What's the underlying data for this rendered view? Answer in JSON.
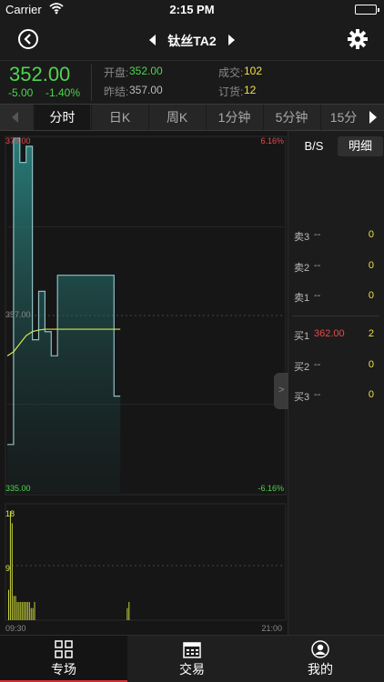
{
  "status_bar": {
    "carrier": "Carrier",
    "time": "2:15 PM"
  },
  "nav": {
    "title": "钛丝TA2"
  },
  "quote": {
    "price": "352.00",
    "change": "-5.00",
    "change_pct": "-1.40%",
    "open_label": "开盘:",
    "open_value": "352.00",
    "prev_settle_label": "昨结:",
    "prev_settle_value": "357.00",
    "volume_label": "成交:",
    "volume_value": "102",
    "orders_label": "订货:",
    "orders_value": "12"
  },
  "tabs": [
    "分时",
    "日K",
    "周K",
    "1分钟",
    "5分钟",
    "15分"
  ],
  "active_tab": 0,
  "chart_data": [
    {
      "type": "line",
      "title": "",
      "y_left_ticks": [
        "379.00",
        "357.00",
        "335.00"
      ],
      "y_right_ticks": [
        "6.16%",
        "-6.16%"
      ],
      "ylim": [
        335.0,
        379.0
      ],
      "series": [
        {
          "values": [
            341.0,
            379.0,
            376.0,
            378.0,
            354.0,
            360.0,
            355.0,
            352.0,
            362.0,
            362.0,
            362.0,
            362.0,
            362.0,
            362.0,
            362.0,
            362.0,
            362.0,
            347.0
          ]
        },
        {
          "values": [
            352.0,
            352.5,
            353.5,
            354.5,
            355.0,
            355.2,
            355.3,
            355.3,
            355.3,
            355.3,
            355.3,
            355.3,
            355.3,
            355.3,
            355.3,
            355.3,
            355.3,
            355.3
          ]
        }
      ]
    },
    {
      "type": "bar",
      "title": "",
      "y_ticks": [
        "18",
        "9"
      ],
      "x_ticks": [
        "09:30",
        "21:00"
      ],
      "ylim": [
        0,
        18
      ],
      "values": [
        5,
        18,
        16,
        4,
        4,
        3,
        3,
        3,
        3,
        3,
        3,
        3,
        3,
        2,
        2,
        3,
        2,
        3
      ]
    }
  ],
  "order_book": {
    "tab_bs": "B/S",
    "tab_detail": "明细",
    "rows": [
      {
        "label": "卖3",
        "price": "--",
        "qty": "0"
      },
      {
        "label": "卖2",
        "price": "--",
        "qty": "0"
      },
      {
        "label": "卖1",
        "price": "--",
        "qty": "0"
      },
      {
        "label": "买1",
        "price": "362.00",
        "qty": "2"
      },
      {
        "label": "买2",
        "price": "--",
        "qty": "0"
      },
      {
        "label": "买3",
        "price": "--",
        "qty": "0"
      }
    ],
    "handle": ">"
  },
  "bottom_nav": [
    {
      "label": "专场",
      "icon": "grid-icon"
    },
    {
      "label": "交易",
      "icon": "calendar-icon"
    },
    {
      "label": "我的",
      "icon": "user-icon"
    }
  ],
  "colors": {
    "up": "#e84a4a",
    "down": "#4fd34f",
    "accent": "#d32f2f",
    "price_line": "#8ec0c4",
    "avg_line": "#d6e84a"
  }
}
